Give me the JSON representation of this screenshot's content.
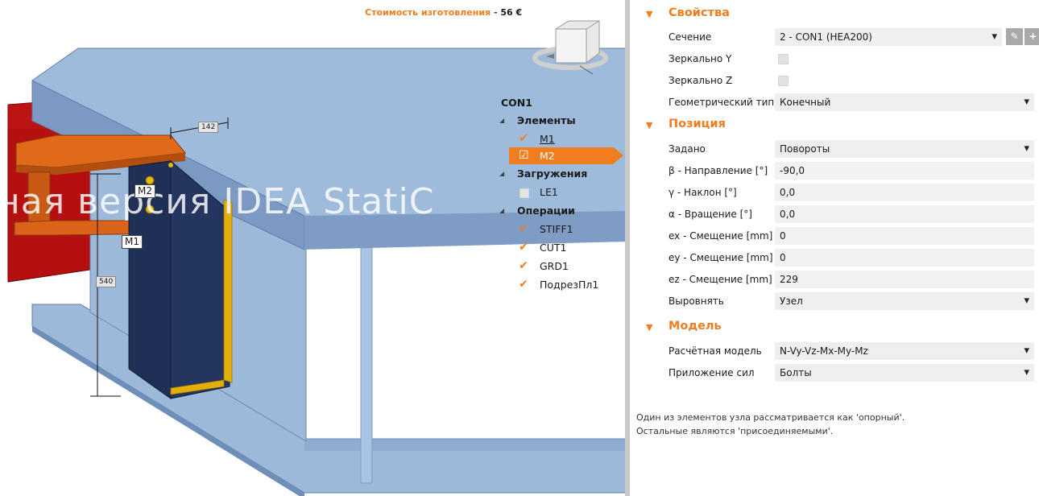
{
  "viewport": {
    "cost_label": "Стоимость изготовления",
    "cost_separator": "-",
    "cost_value": "56 €",
    "watermark": "ная версия IDEA StatiC",
    "dimensions": [
      "142",
      "540"
    ],
    "member_labels": [
      "M2",
      "M1"
    ]
  },
  "tree": {
    "root": "CON1",
    "groups": [
      {
        "title": "Элементы",
        "items": [
          {
            "label": "M1",
            "checked": true
          },
          {
            "label": "M2",
            "checked": true,
            "selected": true
          }
        ]
      },
      {
        "title": "Загружения",
        "items": [
          {
            "label": "LE1",
            "checked": false
          }
        ]
      },
      {
        "title": "Операции",
        "items": [
          {
            "label": "STIFF1",
            "checked": true
          },
          {
            "label": "CUT1",
            "checked": true
          },
          {
            "label": "GRD1",
            "checked": true
          },
          {
            "label": "ПодрезПл1",
            "checked": true
          }
        ]
      }
    ]
  },
  "props": {
    "sections": [
      {
        "title": "Свойства"
      },
      {
        "title": "Позиция"
      },
      {
        "title": "Модель"
      }
    ],
    "section_rows": "Сечение, Зеркально Y, Зеркально Z, Геометрический тип | Задано ... Выровнять | Расчётная модель, Приложение сил",
    "rows": {
      "section": {
        "label": "Сечение",
        "value": "2 - CON1 (HEA200)"
      },
      "mirror_y": {
        "label": "Зеркально Y",
        "checked": false
      },
      "mirror_z": {
        "label": "Зеркально Z",
        "checked": false
      },
      "geom_type": {
        "label": "Геометрический тип",
        "value": "Конечный"
      },
      "defined": {
        "label": "Задано",
        "value": "Повороты"
      },
      "beta": {
        "label": "β - Направление [°]",
        "value": "-90,0"
      },
      "gamma": {
        "label": "γ - Наклон [°]",
        "value": "0,0"
      },
      "alpha": {
        "label": "α - Вращение [°]",
        "value": "0,0"
      },
      "ex": {
        "label": "ex - Смещение [mm]",
        "value": "0"
      },
      "ey": {
        "label": "ey - Смещение [mm]",
        "value": "0"
      },
      "ez": {
        "label": "ez - Смещение [mm]",
        "value": "229"
      },
      "align": {
        "label": "Выровнять",
        "value": "Узел"
      },
      "calc_model": {
        "label": "Расчётная модель",
        "value": "N-Vy-Vz-Mx-My-Mz"
      },
      "force_app": {
        "label": "Приложение сил",
        "value": "Болты"
      }
    },
    "buttons": {
      "edit_icon": "pencil-icon",
      "add_icon": "plus-icon",
      "edit_glyph": "✎",
      "add_glyph": "+"
    },
    "note": [
      "Один из элементов узла рассматривается как 'опорный'.",
      "Остальные являются 'присоединяемыми'."
    ]
  },
  "colors": {
    "accent": "#f07d1f",
    "steel_top": "#9fbbdb",
    "steel_side": "#7e9cc4",
    "plate": "#1d2d52",
    "red_member": "#b20000",
    "weld": "#e8b000"
  }
}
